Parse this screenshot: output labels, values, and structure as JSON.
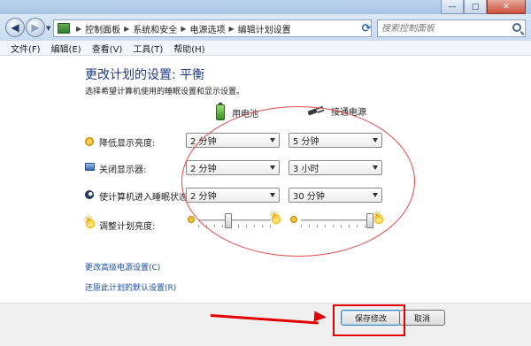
{
  "window": {
    "minimize_glyph": "—",
    "maximize_glyph": "□",
    "close_glyph": "✕"
  },
  "nav": {
    "back_glyph": "◀",
    "forward_glyph": "▶",
    "breadcrumb": [
      "控制面板",
      "系统和安全",
      "电源选项",
      "编辑计划设置"
    ],
    "separator": "▶",
    "refresh_glyph": "⟳",
    "search_placeholder": "搜索控制面板"
  },
  "menu": {
    "items": [
      "文件(F)",
      "编辑(E)",
      "查看(V)",
      "工具(T)",
      "帮助(H)"
    ]
  },
  "page": {
    "title": "更改计划的设置: 平衡",
    "subtitle": "选择希望计算机使用的睡眠设置和显示设置。",
    "columns": {
      "battery": "用电池",
      "plugged_in": "接通电源"
    },
    "rows": [
      {
        "label": "降低显示亮度:",
        "battery": "2 分钟",
        "plugged_in": "5 分钟",
        "icon": "dim-sun-icon"
      },
      {
        "label": "关闭显示器:",
        "battery": "2 分钟",
        "plugged_in": "3 小时",
        "icon": "monitor-icon"
      },
      {
        "label": "使计算机进入睡眠状态:",
        "battery": "2 分钟",
        "plugged_in": "30 分钟",
        "icon": "moon-icon"
      }
    ],
    "brightness": {
      "label": "调整计划亮度:",
      "battery_level": 0.4,
      "plugged_in_level": 1.0
    },
    "links": {
      "advanced": "更改高级电源设置(C)",
      "restore": "还原此计划的默认设置(R)"
    }
  },
  "buttons": {
    "save": "保存修改",
    "cancel": "取消"
  },
  "annotation_colors": {
    "ellipse": "#e34a4a",
    "highlight": "#e30000"
  }
}
